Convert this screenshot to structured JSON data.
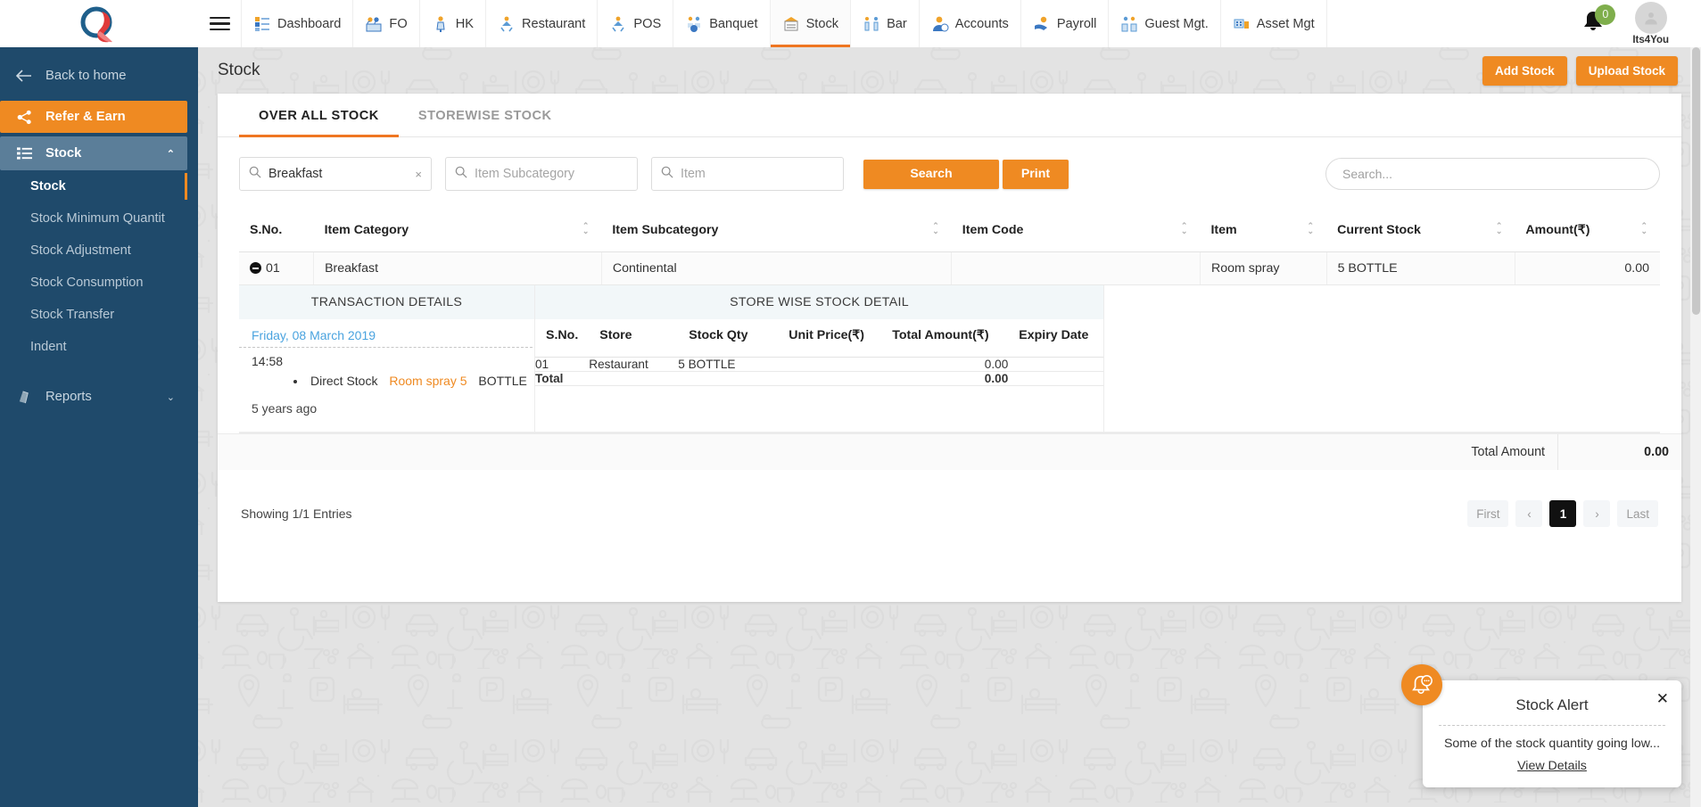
{
  "app": {
    "brand_color": "#ef8a22",
    "sidebar_color": "#1f4a6b",
    "profile_name": "Its4You",
    "avatar_initials": "",
    "notification_count": "0"
  },
  "topnav": {
    "hamburger": "menu-icon",
    "items": [
      {
        "label": "Dashboard",
        "icon": "dashboard-icon",
        "active": false
      },
      {
        "label": "FO",
        "icon": "front-office-icon",
        "active": false
      },
      {
        "label": "HK",
        "icon": "housekeeping-icon",
        "active": false
      },
      {
        "label": "Restaurant",
        "icon": "restaurant-icon",
        "active": false
      },
      {
        "label": "POS",
        "icon": "pos-icon",
        "active": false
      },
      {
        "label": "Banquet",
        "icon": "banquet-icon",
        "active": false
      },
      {
        "label": "Stock",
        "icon": "stock-icon",
        "active": true
      },
      {
        "label": "Bar",
        "icon": "bar-icon",
        "active": false
      },
      {
        "label": "Accounts",
        "icon": "accounts-icon",
        "active": false
      },
      {
        "label": "Payroll",
        "icon": "payroll-icon",
        "active": false
      },
      {
        "label": "Guest Mgt.",
        "icon": "guest-management-icon",
        "active": false
      },
      {
        "label": "Asset Mgt",
        "icon": "asset-management-icon",
        "active": false
      }
    ]
  },
  "sidebar": {
    "back_label": "Back to home",
    "refer_label": "Refer & Earn",
    "group_label": "Stock",
    "sub_items": [
      {
        "label": "Stock",
        "active": true
      },
      {
        "label": "Stock Minimum Quantit",
        "active": false
      },
      {
        "label": "Stock Adjustment",
        "active": false
      },
      {
        "label": "Stock Consumption",
        "active": false
      },
      {
        "label": "Stock Transfer",
        "active": false
      },
      {
        "label": "Indent",
        "active": false
      }
    ],
    "reports_label": "Reports"
  },
  "page": {
    "title": "Stock",
    "add_stock_label": "Add Stock",
    "upload_stock_label": "Upload Stock"
  },
  "tabs": [
    {
      "label": "OVER ALL STOCK",
      "active": true
    },
    {
      "label": "STOREWISE STOCK",
      "active": false
    }
  ],
  "filters": {
    "category_value": "Breakfast",
    "category_clear": "×",
    "subcategory_placeholder": "Item Subcategory",
    "item_placeholder": "Item",
    "search_button": "Search",
    "print_button": "Print",
    "table_search_placeholder": "Search..."
  },
  "table": {
    "headers": [
      "S.No.",
      "Item Category",
      "Item Subcategory",
      "Item Code",
      "Item",
      "Current Stock",
      "Amount(₹)"
    ],
    "rows": [
      {
        "sno": "01",
        "item_category": "Breakfast",
        "item_subcategory": "Continental",
        "item_code": "",
        "item": "Room spray",
        "current_stock": "5 BOTTLE",
        "amount": "0.00"
      }
    ],
    "total_label": "Total Amount",
    "total_value": "0.00"
  },
  "detail": {
    "transaction_title": "TRANSACTION DETAILS",
    "transaction_date": "Friday, 08 March 2019",
    "transaction_time": "14:58",
    "transaction_type": "Direct Stock",
    "transaction_item": "Room spray 5",
    "transaction_unit": "BOTTLE",
    "transaction_ago": "5 years ago",
    "storewise_title": "STORE WISE STOCK DETAIL",
    "storewise_headers": [
      "S.No.",
      "Store",
      "Stock Qty",
      "Unit Price(₹)",
      "Total Amount(₹)",
      "Expiry Date"
    ],
    "storewise_rows": [
      {
        "sno": "01",
        "store": "Restaurant",
        "stock_qty": "5  BOTTLE",
        "unit_price": "",
        "total_amount": "0.00",
        "expiry_date": ""
      }
    ],
    "storewise_total_label": "Total",
    "storewise_total_value": "0.00"
  },
  "footer": {
    "entries": "Showing 1/1 Entries",
    "pagination": {
      "first": "First",
      "prev": "‹",
      "current": "1",
      "next": "›",
      "last": "Last"
    }
  },
  "toast": {
    "title": "Stock Alert",
    "close": "✕",
    "message": "Some of the stock quantity going low...",
    "link": "View Details",
    "icon": "bell-alert-icon"
  }
}
